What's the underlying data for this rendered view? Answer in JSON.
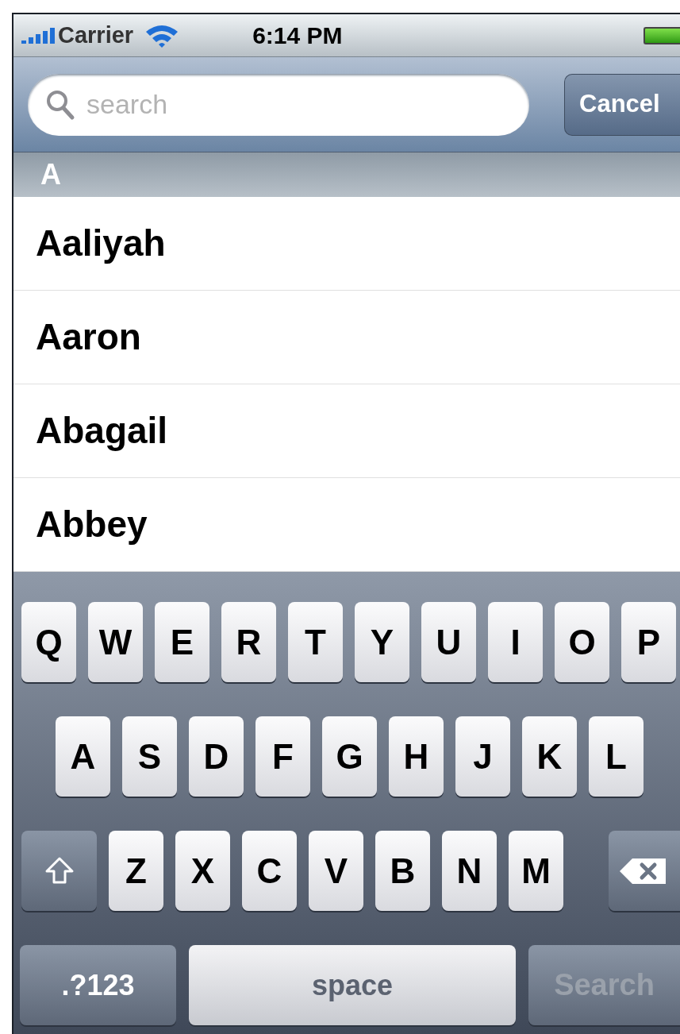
{
  "status_bar": {
    "carrier": "Carrier",
    "time": "6:14 PM"
  },
  "search_bar": {
    "placeholder": "search",
    "cancel": "Cancel"
  },
  "section": {
    "title": "A"
  },
  "rows": [
    {
      "name": "Aaliyah"
    },
    {
      "name": "Aaron"
    },
    {
      "name": "Abagail"
    },
    {
      "name": "Abbey"
    }
  ],
  "keyboard": {
    "bottom_row": {
      "mode_key": ".?123",
      "space_key": "space",
      "search_key": {
        "label": "Search",
        "disabled": true
      }
    },
    "rows": [
      [
        {
          "kind": "letter",
          "label": "Q"
        },
        {
          "kind": "letter",
          "label": "W"
        },
        {
          "kind": "letter",
          "label": "E"
        },
        {
          "kind": "letter",
          "label": "R"
        },
        {
          "kind": "letter",
          "label": "T"
        },
        {
          "kind": "letter",
          "label": "Y"
        },
        {
          "kind": "letter",
          "label": "U"
        },
        {
          "kind": "letter",
          "label": "I"
        },
        {
          "kind": "letter",
          "label": "O"
        },
        {
          "kind": "letter",
          "label": "P"
        }
      ],
      [
        {
          "kind": "letter",
          "label": "A"
        },
        {
          "kind": "letter",
          "label": "S"
        },
        {
          "kind": "letter",
          "label": "D"
        },
        {
          "kind": "letter",
          "label": "F"
        },
        {
          "kind": "letter",
          "label": "G"
        },
        {
          "kind": "letter",
          "label": "H"
        },
        {
          "kind": "letter",
          "label": "J"
        },
        {
          "kind": "letter",
          "label": "K"
        },
        {
          "kind": "letter",
          "label": "L"
        }
      ],
      [
        {
          "kind": "shift"
        },
        {
          "kind": "letter",
          "label": "Z"
        },
        {
          "kind": "letter",
          "label": "X"
        },
        {
          "kind": "letter",
          "label": "C"
        },
        {
          "kind": "letter",
          "label": "V"
        },
        {
          "kind": "letter",
          "label": "B"
        },
        {
          "kind": "letter",
          "label": "N"
        },
        {
          "kind": "letter",
          "label": "M"
        },
        {
          "kind": "backspace"
        }
      ]
    ]
  }
}
